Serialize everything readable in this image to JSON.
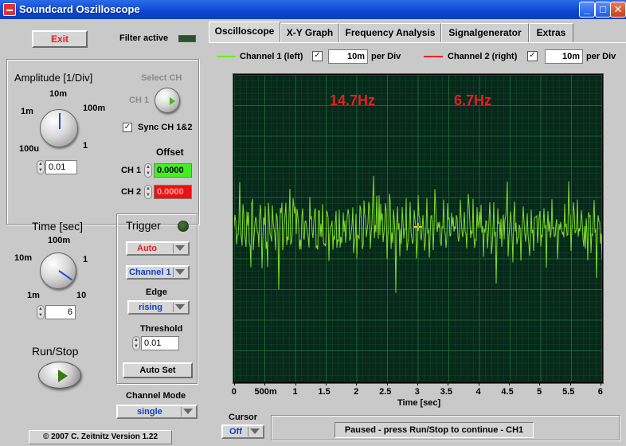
{
  "window": {
    "title": "Soundcard Oszilloscope",
    "minimize": "_",
    "maximize": "□",
    "close": "✕"
  },
  "left": {
    "exit_label": "Exit",
    "filter_label": "Filter active",
    "amplitude": {
      "title": "Amplitude [1/Div]",
      "scale": [
        "1m",
        "10m",
        "100m",
        "1",
        "100u"
      ],
      "value": "0.01"
    },
    "select_ch": {
      "label": "Select CH",
      "ch1": "CH 1"
    },
    "sync": {
      "label": "Sync CH 1&2",
      "checked": "✓"
    },
    "offset": {
      "label": "Offset",
      "ch1_label": "CH 1",
      "ch1_value": "0.0000",
      "ch2_label": "CH 2",
      "ch2_value": "0.0000"
    },
    "time": {
      "title": "Time [sec]",
      "scale": [
        "100m",
        "10m",
        "1",
        "1m",
        "10"
      ],
      "value": "6"
    },
    "trigger": {
      "title": "Trigger",
      "mode": "Auto",
      "channel": "Channel 1",
      "edge_label": "Edge",
      "edge": "rising",
      "threshold_label": "Threshold",
      "threshold": "0.01",
      "autoset": "Auto Set"
    },
    "run_stop": "Run/Stop",
    "channel_mode": {
      "label": "Channel Mode",
      "value": "single"
    },
    "copyright": "© 2007  C. Zeitnitz Version 1.22"
  },
  "tabs": [
    {
      "label": "Oscilloscope"
    },
    {
      "label": "X-Y Graph"
    },
    {
      "label": "Frequency Analysis"
    },
    {
      "label": "Signalgenerator"
    },
    {
      "label": "Extras"
    }
  ],
  "channels": {
    "ch1": {
      "label": "Channel 1 (left)",
      "checked": "✓",
      "value": "10m",
      "unit": "per Div",
      "color": "#66ee22"
    },
    "ch2": {
      "label": "Channel 2 (right)",
      "checked": "✓",
      "value": "10m",
      "unit": "per Div",
      "color": "#ee2222"
    }
  },
  "scope": {
    "freq1": "14.7Hz",
    "freq2": "6.7Hz",
    "xlabel": "Time [sec]",
    "xticks": [
      "0",
      "500m",
      "1",
      "1.5",
      "2",
      "2.5",
      "3",
      "3.5",
      "4",
      "4.5",
      "5",
      "5.5",
      "6"
    ],
    "colors": {
      "background": "#07281a",
      "grid": "#1f6b3a",
      "trace": "#7fdc28"
    }
  },
  "cursor": {
    "label": "Cursor",
    "value": "Off"
  },
  "status": "Paused - press Run/Stop to continue - CH1"
}
